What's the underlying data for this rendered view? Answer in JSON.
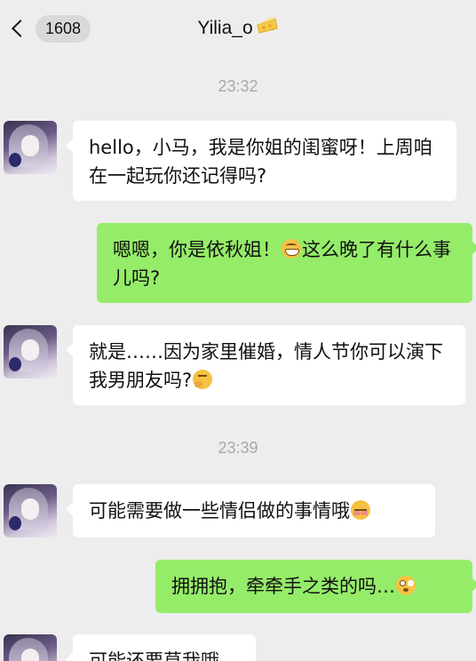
{
  "header": {
    "unread_count": "1608",
    "contact_name": "Yilia_o"
  },
  "times": [
    "23:32",
    "23:39"
  ],
  "messages": [
    {
      "side": "in",
      "text": "hello，小马，我是你姐的闺蜜呀！上周咱在一起玩你还记得吗?"
    },
    {
      "side": "out",
      "text_a": "嗯嗯，你是依秋姐！",
      "emoji": "grinning-face-emoji",
      "text_b": "这么晚了有什么事儿吗?"
    },
    {
      "side": "in",
      "text": "就是……因为家里催婚，情人节你可以演下我男朋友吗?",
      "emoji": "thinking-face-emoji"
    },
    {
      "side": "in",
      "text": "可能需要做一些情侣做的事情哦",
      "emoji": "shy-face-emoji"
    },
    {
      "side": "out",
      "text": "拥拥抱，牵牵手之类的吗…",
      "emoji": "flushed-face-emoji"
    },
    {
      "side": "in",
      "text": "可能还要草我哦"
    }
  ],
  "colors": {
    "background": "#ededed",
    "incoming_bubble": "#ffffff",
    "outgoing_bubble": "#95ec69",
    "timestamp": "#a8a8a8"
  }
}
